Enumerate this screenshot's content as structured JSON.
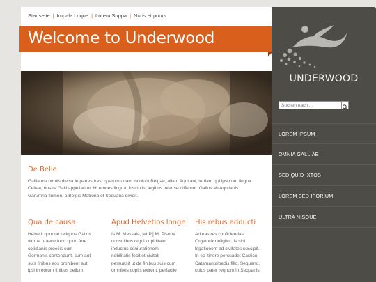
{
  "breadcrumb": {
    "items": [
      "Startseite",
      "Impala Loque",
      "Lorem Suppa",
      "Noris et pours"
    ],
    "separator": "|"
  },
  "banner": {
    "title": "Welcome to Underwood"
  },
  "hero": {
    "alt": ""
  },
  "intro": {
    "heading": "De Bello",
    "lines": [
      "Gallia est omnis divisa in partes tres, quarum unam incolunt Belgae, aliam Aquitani, tertiam qui ipsorum lingua",
      "Celtae, nostra Galli appellantur. Hi omnes lingua, institutis, legibus inter se differunt. Gallos ab Aquitanis",
      "Garumna flumen, a Belgis Matrona et Sequana dividit."
    ]
  },
  "columns": [
    {
      "heading": "Qua de causa",
      "lines": [
        "Helvetii quoque reliquos Gallos",
        "virtute praecedunt, quod fere",
        "cotidianis proeliis cum",
        "Germanis contendunt, cum aut",
        "suis finibus eos prohibent aut",
        "ipsi in eorum finibus bellum"
      ]
    },
    {
      "heading": "Apud Helvetios longe",
      "lines": [
        "Is M. Messala, [et P.] M. Pisone",
        "consulibus regni cupiditate",
        "inductus coniurationem",
        "nobilitatis fecit et civitati",
        "persuasit ut de finibus suis cum",
        "omnibus copiis exirent: perfacile"
      ]
    },
    {
      "heading": "His rebus adducti",
      "lines": [
        "Ad eas res conficiendas",
        "Orgetorix deligitur. Is sibi",
        "legationem ad civitates suscipit.",
        "In eo itinere persuadet Castico,",
        "Catamantaloedis filio, Sequano,",
        "cuius pater regnum in Sequanis"
      ]
    }
  ],
  "sidebar": {
    "brand": "UNDERWOOD",
    "search_placeholder": "Suchen nach ...",
    "search_icon": "search-icon",
    "menu": [
      "LOREM IPSUM",
      "OMNIA GALLIAE",
      "SED QUID IXTOS",
      "LOREM SED IPORIUM",
      "ULTRA NISQUE"
    ]
  },
  "colors": {
    "accent": "#d9601c",
    "sidebar": "#4d4c47",
    "heading": "#d9692f",
    "background": "#e6e5e2"
  }
}
